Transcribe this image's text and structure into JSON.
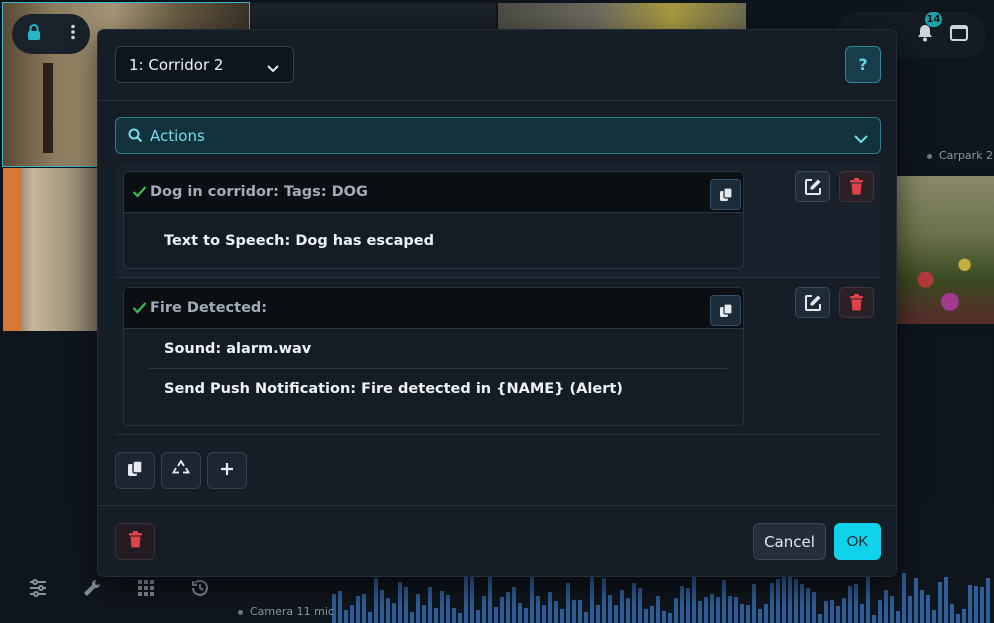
{
  "background": {
    "labels": {
      "carpark2": "Carpark 2",
      "camera11mic": "Camera 11 mic"
    },
    "notifications": {
      "count": "14"
    },
    "icons": {
      "lock": "lock-icon",
      "menu": "kebab-menu-icon",
      "bell": "bell-icon",
      "window": "window-icon",
      "sliders": "sliders-icon",
      "wrench": "wrench-icon",
      "grid": "grid-icon",
      "history": "history-icon"
    },
    "colors": {
      "accent": "#10d2ea",
      "delete": "#e0424c",
      "check": "#3fb950"
    }
  },
  "modal": {
    "camera_select": {
      "value": "1: Corridor 2"
    },
    "help_label": "?",
    "actions_filter": {
      "label": "Actions"
    },
    "rules": [
      {
        "title": "Dog in corridor: Tags: DOG",
        "actions": [
          "Text to Speech: Dog has escaped"
        ]
      },
      {
        "title": "Fire Detected:",
        "actions": [
          "Sound: alarm.wav",
          "Send Push Notification: Fire detected in {NAME} (Alert)"
        ]
      }
    ],
    "toolbar": {
      "copy": "copy-icon",
      "recycle": "recycle-icon",
      "add": "plus-icon"
    },
    "footer": {
      "cancel_label": "Cancel",
      "ok_label": "OK"
    }
  }
}
